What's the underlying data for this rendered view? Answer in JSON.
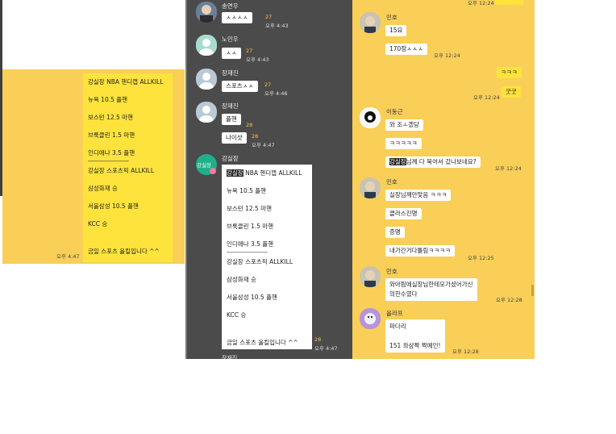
{
  "left_card": {
    "lines": [
      "강실장 NBA 핸디캡 ALLKILL",
      "뉴욕 10.5 플핸",
      "보스턴 12.5 마핸",
      "브룩클린 1.5 마핸",
      "인디애나 3.5 플핸",
      "──────────────",
      "강실장 스포츠픽 ALLKILL",
      "삼성화재 승",
      "서울삼성 10.5 플핸",
      "KCC 승",
      "",
      "금일 스포츠 올킬입니다 ^^"
    ],
    "time": "오후 4:47"
  },
  "middle": {
    "messages": [
      {
        "name": "송연우",
        "text": "ㅅㅅㅅㅅ",
        "count": "27",
        "time": "오후 4:43"
      },
      {
        "name": "노민우",
        "text": "ㅅㅅ",
        "count": "27",
        "time": "오후 4:43"
      },
      {
        "name": "장재진",
        "text": "스포츠ㅅㅅ",
        "count": "27",
        "time": "오후 4:46"
      },
      {
        "name": "장재진",
        "text": "플핸",
        "count": "28",
        "text2": "나이샷",
        "count2": "28",
        "time": "오후 4:47"
      }
    ],
    "admin": {
      "name": "강실장",
      "avatar_label": "강실장",
      "highlight": "강실장",
      "first_line_rest": " NBA 핸디캡 ALLKILL",
      "lines": [
        "뉴욕 10.5 플핸",
        "보스턴 12.5 마핸",
        "브룩클린 1.5 마핸",
        "인디애나 3.5 플핸",
        "──────────────",
        "강실장 스포츠픽 ALLKILL",
        "삼성화재 승",
        "서울삼성 10.5 플핸",
        "KCC 승",
        "",
        "금일 스포츠 올킬입니다 ^^"
      ],
      "count": "28",
      "time": "오후 4:47"
    },
    "next_name": "장재진"
  },
  "right": {
    "top_time": "오후 12:24",
    "minho1": {
      "name": "민호",
      "msg1": "15요",
      "msg2": "170장ㅅㅅㅅ",
      "time": "오후 12:24"
    },
    "mine": {
      "msg1": "ㅋㅋㅋ",
      "msg2": "굿굿",
      "time": "오후 12:24"
    },
    "lee": {
      "name": "이동근",
      "msg1": "와 조ㅗ겠당",
      "msg2": "ㅋㅋㅋㅋㅋ",
      "highlight": "강실장",
      "msg3_rest": "님께 다 묵어서 갔나보네요?",
      "time": "오후 12:24"
    },
    "minho2": {
      "name": "민호",
      "msg1": "실장님께만맞음 ㅋㅋㅋ",
      "msg2": "클라스진명",
      "msg3": "증명",
      "msg4": "내가간거다틀림ㅋㅋㅋㅋ",
      "time": "오후 12:25"
    },
    "minho3": {
      "name": "민호",
      "msg1_l1": "와아핌에실장님한테모가셨어가신",
      "msg1_l2": "의한수였다",
      "time": "오후 12:28"
    },
    "olaf": {
      "name": "올라프",
      "msg1": "파다리",
      "msg2": "151 좌삼짝 짝예인!",
      "time": "오후 12:28"
    }
  },
  "colors": {
    "kakao_yellow": "#f9cf58",
    "bubble_yellow": "#fee33c",
    "dark_bg": "#4b4b4b"
  }
}
